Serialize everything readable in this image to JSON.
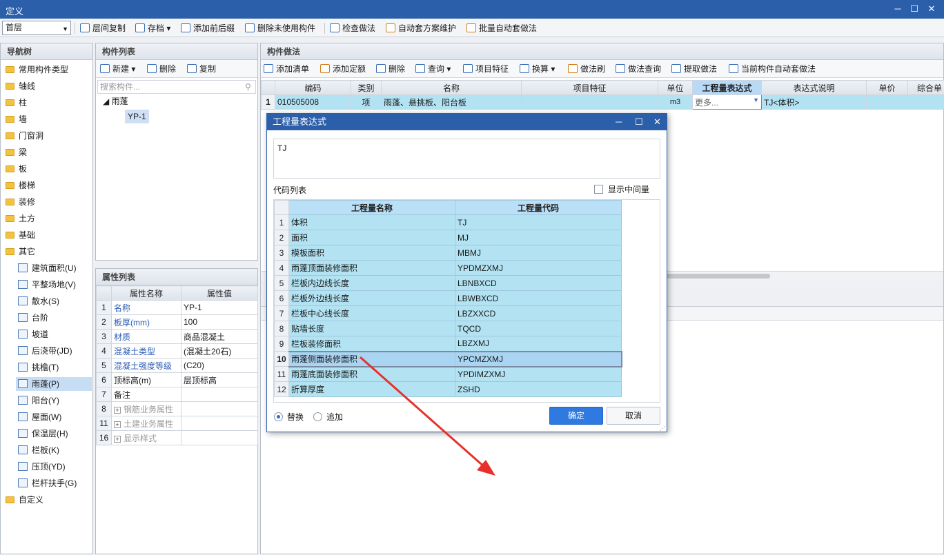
{
  "window": {
    "title": "定义",
    "min": "─",
    "max": "☐",
    "close": "✕"
  },
  "toolbar": {
    "floor": "首层",
    "items": [
      "层间复制",
      "存档",
      "添加前后缀",
      "删除未使用构件",
      "检查做法",
      "自动套方案维护",
      "批量自动套做法"
    ]
  },
  "nav": {
    "title": "导航树",
    "items": [
      "常用构件类型",
      "轴线",
      "柱",
      "墙",
      "门窗洞",
      "梁",
      "板",
      "楼梯",
      "装修",
      "土方",
      "基础",
      "其它"
    ],
    "sub": [
      "建筑面积(U)",
      "平整场地(V)",
      "散水(S)",
      "台阶",
      "坡道",
      "后浇带(JD)",
      "挑檐(T)",
      "雨蓬(P)",
      "阳台(Y)",
      "屋面(W)",
      "保温层(H)",
      "栏板(K)",
      "压顶(YD)",
      "栏杆扶手(G)"
    ],
    "last": "自定义"
  },
  "comp": {
    "title": "构件列表",
    "new": "新建",
    "delete": "删除",
    "copy": "复制",
    "search_placeholder": "搜索构件...",
    "tree_root": "雨蓬",
    "tree_child": "YP-1"
  },
  "props": {
    "title": "属性列表",
    "col_name": "属性名称",
    "col_value": "属性值",
    "rows": [
      [
        "1",
        "名称",
        "YP-1"
      ],
      [
        "2",
        "板厚(mm)",
        "100"
      ],
      [
        "3",
        "材质",
        "商品混凝土"
      ],
      [
        "4",
        "混凝土类型",
        "(混凝土20石)"
      ],
      [
        "5",
        "混凝土强度等级",
        "(C20)"
      ],
      [
        "6",
        "顶标高(m)",
        "层顶标高"
      ],
      [
        "7",
        "备注",
        ""
      ],
      [
        "8",
        "钢筋业务属性",
        ""
      ],
      [
        "11",
        "土建业务属性",
        ""
      ],
      [
        "16",
        "显示样式",
        ""
      ]
    ]
  },
  "method": {
    "title": "构件做法",
    "tools": [
      "添加清单",
      "添加定额",
      "删除",
      "查询",
      "项目特征",
      "换算",
      "做法刷",
      "做法查询",
      "提取做法",
      "当前构件自动套做法"
    ],
    "headers": [
      "编码",
      "类别",
      "名称",
      "项目特征",
      "单位",
      "工程量表达式",
      "表达式说明",
      "单价",
      "综合单"
    ],
    "row": {
      "no": "1",
      "code": "010505008",
      "type": "项",
      "name": "雨蓬、悬挑板、阳台板",
      "feature": "",
      "unit": "m3",
      "expr": "更多...",
      "desc": "TJ<体积>"
    }
  },
  "dialog": {
    "title": "工程量表达式",
    "expr": "TJ",
    "code_list": "代码列表",
    "show_mid": "显示中间量",
    "col_name": "工程量名称",
    "col_code": "工程量代码",
    "rows": [
      [
        "1",
        "体积",
        "TJ"
      ],
      [
        "2",
        "面积",
        "MJ"
      ],
      [
        "3",
        "模板面积",
        "MBMJ"
      ],
      [
        "4",
        "雨蓬顶面装修面积",
        "YPDMZXMJ"
      ],
      [
        "5",
        "栏板内边线长度",
        "LBNBXCD"
      ],
      [
        "6",
        "栏板外边线长度",
        "LBWBXCD"
      ],
      [
        "7",
        "栏板中心线长度",
        "LBZXXCD"
      ],
      [
        "8",
        "贴墙长度",
        "TQCD"
      ],
      [
        "9",
        "栏板装修面积",
        "LBZXMJ"
      ],
      [
        "10",
        "雨蓬侧面装修面积",
        "YPCMZXMJ"
      ],
      [
        "11",
        "雨蓬底面装修面积",
        "YPDIMZXMJ"
      ],
      [
        "12",
        "折算厚度",
        "ZSHD"
      ]
    ],
    "replace": "替换",
    "append": "追加",
    "ok": "确定",
    "cancel": "取消"
  }
}
